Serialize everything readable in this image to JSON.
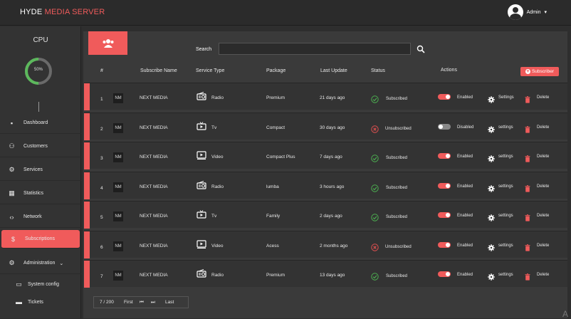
{
  "brand": {
    "name": "HYDE",
    "accent": "MEDIA SERVER",
    "accent_color": "#f05b5b"
  },
  "user": {
    "name": "Admin",
    "caret": "▾",
    "icon": "user-avatar-icon"
  },
  "sidebar": {
    "cpu_title": "CPU",
    "cpu_percent_label": "50%",
    "cpu_fraction": 0.5,
    "items": [
      {
        "label": "Dashboard",
        "icon": "dashboard-icon"
      },
      {
        "label": "Customers",
        "icon": "customers-icon"
      },
      {
        "label": "Services",
        "icon": "services-icon"
      },
      {
        "label": "Statistics",
        "icon": "statistics-icon"
      },
      {
        "label": "Network",
        "icon": "network-icon"
      },
      {
        "label": "Subscriptions",
        "icon": "subscriptions-icon",
        "active": true
      },
      {
        "label": "Administration",
        "icon": "administration-icon",
        "caret": "⌄"
      },
      {
        "label": "System config",
        "icon": "system-config-icon"
      },
      {
        "label": "Tickets",
        "icon": "tickets-icon"
      }
    ]
  },
  "toolbar": {
    "search_label": "Search",
    "search_placeholder": ""
  },
  "table": {
    "headers": [
      "#",
      "Subscribe Name",
      "Service Type",
      "Package",
      "Last Update",
      "Status",
      "Actions"
    ],
    "add_button": "Subscriber",
    "rows": [
      {
        "num": "1",
        "badge": "NM",
        "name": "NEXT MEDIA",
        "service": "Radio",
        "package": "Premium",
        "updated": "21 days ago",
        "status": "Subscribed",
        "subscribed": true,
        "toggle": "Enabled",
        "enabled": true,
        "settings": "Settings",
        "delete": "Delete"
      },
      {
        "num": "2",
        "badge": "NM",
        "name": "NEXT MEDIA",
        "service": "Tv",
        "package": "Compact",
        "updated": "30 days ago",
        "status": "Unsubscribed",
        "subscribed": false,
        "toggle": "Disabled",
        "enabled": false,
        "settings": "settings",
        "delete": "Delete"
      },
      {
        "num": "3",
        "badge": "NM",
        "name": "NEXT MEDIA",
        "service": "Video",
        "package": "Compact Plus",
        "updated": "7 days ago",
        "status": "Subscribed",
        "subscribed": true,
        "toggle": "Enabled",
        "enabled": true,
        "settings": "settings",
        "delete": "Delete"
      },
      {
        "num": "4",
        "badge": "NM",
        "name": "NEXT MEDIA",
        "service": "Radio",
        "package": "lumba",
        "updated": "3 hours ago",
        "status": "Subscribed",
        "subscribed": true,
        "toggle": "Enabled",
        "enabled": true,
        "settings": "settings",
        "delete": "Delete"
      },
      {
        "num": "5",
        "badge": "NM",
        "name": "NEXT MEDIA",
        "service": "Tv",
        "package": "Family",
        "updated": "2 days ago",
        "status": "Subscribed",
        "subscribed": true,
        "toggle": "Enabled",
        "enabled": true,
        "settings": "settings",
        "delete": "Delete"
      },
      {
        "num": "6",
        "badge": "NM",
        "name": "NEXT MEDIA",
        "service": "Video",
        "package": "Acess",
        "updated": "2 months ago",
        "status": "Unsubscribed",
        "subscribed": false,
        "toggle": "Enabled",
        "enabled": true,
        "settings": "settings",
        "delete": "Delete"
      },
      {
        "num": "7",
        "badge": "NM",
        "name": "NEXT MEDIA",
        "service": "Radio",
        "package": "Premium",
        "updated": "13 days ago",
        "status": "Subscribed",
        "subscribed": true,
        "toggle": "Enabled",
        "enabled": true,
        "settings": "settings",
        "delete": "Delete"
      }
    ]
  },
  "pager": {
    "count": "7 / 200",
    "first": "First",
    "prev": "⏮",
    "next": "⏭",
    "last": "Last"
  },
  "colors": {
    "accent": "#f05b5b",
    "success": "#4caf50",
    "danger": "#e05050"
  }
}
